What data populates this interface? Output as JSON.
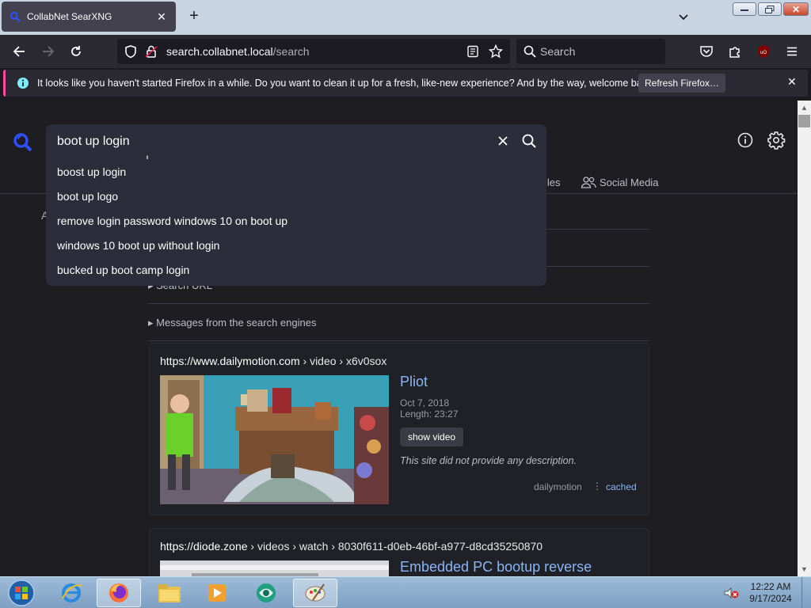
{
  "browser": {
    "tab_title": "CollabNet SearXNG",
    "url_host": "search.collabnet.local",
    "url_path": "/search",
    "search_placeholder": "Search",
    "notification": {
      "message": "It looks like you haven't started Firefox in a while. Do you want to clean it up for a fresh, like-new experience? And by the way, welcome back!",
      "refresh_label": "Refresh Firefox…"
    }
  },
  "search": {
    "query": "boot up login",
    "suggestions": [
      "boost up login",
      "boot up logo",
      "remove login password windows 10 on boot up",
      "windows 10 boot up without login",
      "bucked up boot camp login"
    ]
  },
  "categories": {
    "files_partial": "iles",
    "social_media": "Social Media"
  },
  "page": {
    "stray_letter": "A",
    "search_url_label": "Search URL",
    "engines_label": "Messages from the search engines"
  },
  "results": [
    {
      "url_base": "https://www.dailymotion.com",
      "url_path": " › video › x6v0sox",
      "title": "Pliot",
      "date": "Oct 7, 2018",
      "length": "Length: 23:27",
      "button": "show video",
      "description": "This site did not provide any description.",
      "engine": "dailymotion",
      "cached": "cached"
    },
    {
      "url_base": "https://diode.zone",
      "url_path": " › videos › watch › 8030f611-d0eb-46bf-a977-d8cd35250870",
      "title": "Embedded PC bootup reverse"
    }
  ],
  "taskbar": {
    "time": "12:22 AM",
    "date": "9/17/2024"
  },
  "colors": {
    "accent_link": "#8ab4f8",
    "notification_accent": "#ff4aa2",
    "page_bg": "#1d1d22"
  }
}
